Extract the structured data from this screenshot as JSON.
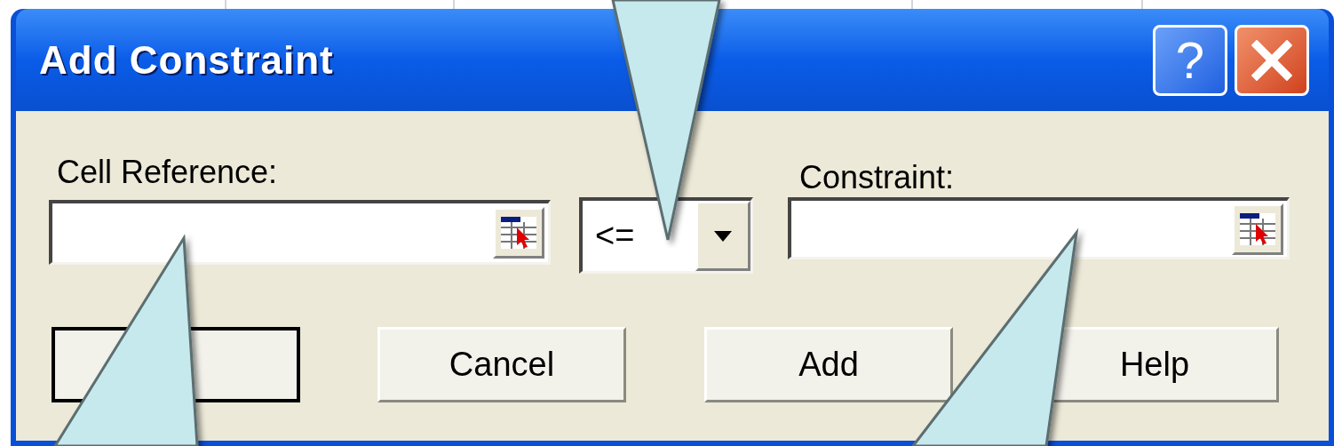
{
  "window": {
    "title": "Add Constraint"
  },
  "title_buttons": [
    {
      "kind": "help",
      "label": "?"
    },
    {
      "kind": "close"
    }
  ],
  "cell_reference": {
    "label": "Cell Reference:"
  },
  "operator": {
    "value": "<="
  },
  "constraint": {
    "label": "Constraint:"
  },
  "buttons": [
    {
      "default": true
    },
    {
      "label": "Cancel",
      "default": false
    },
    {
      "label": "Add",
      "default": false
    },
    {
      "label": "Help",
      "default": false
    }
  ]
}
